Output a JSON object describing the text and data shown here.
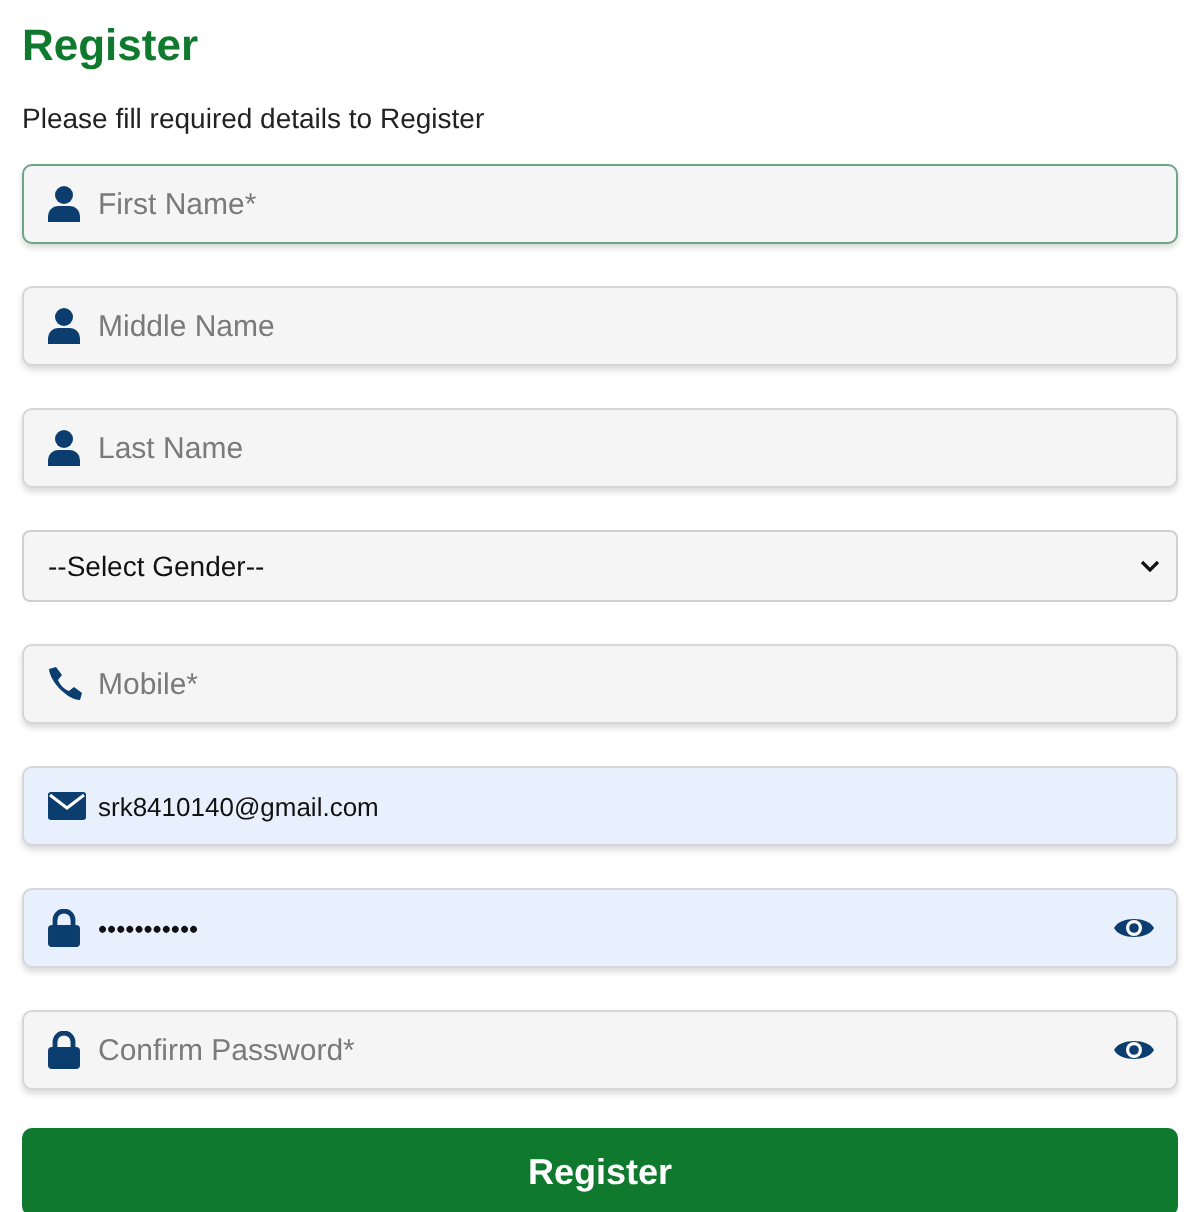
{
  "title": "Register",
  "subtitle": "Please fill required details to Register",
  "fields": [
    {
      "kind": "name",
      "placeholder": "First Name*",
      "focused": true,
      "autofilled": false
    },
    {
      "kind": "name",
      "placeholder": "Middle Name",
      "focused": false,
      "autofilled": false
    },
    {
      "kind": "name",
      "placeholder": "Last Name",
      "focused": false,
      "autofilled": false
    },
    {
      "kind": "select",
      "value": "--Select Gender--",
      "focused": false,
      "autofilled": false
    },
    {
      "kind": "phone",
      "placeholder": "Mobile*",
      "focused": false,
      "autofilled": false
    },
    {
      "kind": "email",
      "value": "srk8410140@gmail.com",
      "focused": false,
      "autofilled": true
    },
    {
      "kind": "password",
      "value": "•••••••••••",
      "focused": false,
      "autofilled": true
    },
    {
      "kind": "password",
      "placeholder": "Confirm Password*",
      "focused": false,
      "autofilled": false
    }
  ],
  "button": "Register"
}
